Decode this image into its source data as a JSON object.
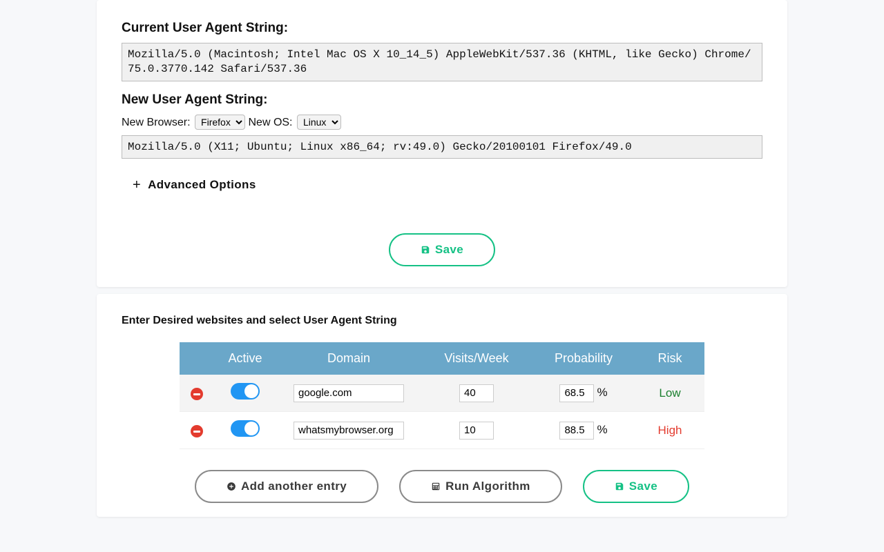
{
  "section1": {
    "current_label": "Current User Agent String:",
    "current_ua": "Mozilla/5.0 (Macintosh; Intel Mac OS X 10_14_5) AppleWebKit/537.36 (KHTML, like Gecko) Chrome/75.0.3770.142 Safari/537.36",
    "new_label": "New User Agent String:",
    "browser_label": "New Browser:",
    "browser_selected": "Firefox",
    "os_label": "New OS:",
    "os_selected": "Linux",
    "new_ua": "Mozilla/5.0 (X11; Ubuntu; Linux x86_64; rv:49.0) Gecko/20100101 Firefox/49.0",
    "advanced_label": "Advanced Options",
    "save_label": "Save"
  },
  "section2": {
    "title": "Enter Desired websites and select User Agent String",
    "cols": {
      "active": "Active",
      "domain": "Domain",
      "visits": "Visits/Week",
      "prob": "Probability",
      "risk": "Risk"
    },
    "rows": [
      {
        "domain": "google.com",
        "visits": "40",
        "prob": "68.5",
        "risk": "Low",
        "risk_class": "risk-low"
      },
      {
        "domain": "whatsmybrowser.org",
        "visits": "10",
        "prob": "88.5",
        "risk": "High",
        "risk_class": "risk-high"
      }
    ],
    "pct_symbol": "%",
    "add_label": "Add another entry",
    "run_label": "Run Algorithm",
    "save_label": "Save"
  }
}
